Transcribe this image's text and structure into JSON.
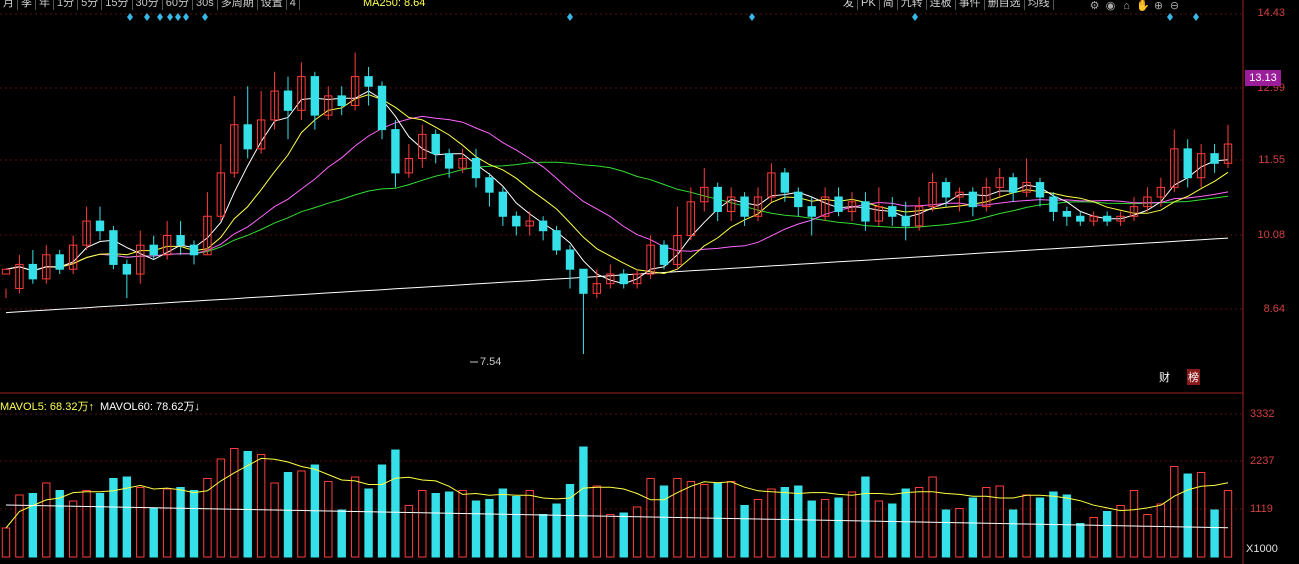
{
  "toolbar": {
    "periods": [
      "月",
      "季",
      "年",
      "1分",
      "5分",
      "15分",
      "30分",
      "60分",
      "30s"
    ],
    "actions": [
      "多周期",
      "设置",
      "4"
    ],
    "ma_status": "MA250: 8.64",
    "right_items": [
      "发",
      "PK",
      "简",
      "九转",
      "连板",
      "事件"
    ],
    "right_items2": [
      "删自选",
      "均线"
    ],
    "icons": [
      "settings-icon",
      "eye-icon",
      "home-icon",
      "hand-icon",
      "zoom-in-icon",
      "zoom-out-icon"
    ]
  },
  "price_axis": [
    "14.43",
    "12.99",
    "11.55",
    "10.08",
    "8.64"
  ],
  "highlight_price": "13.13",
  "low_label": "7.54",
  "badges": {
    "cai": "财",
    "bang": "榜"
  },
  "volume": {
    "mavol5_label": "MAVOL5: 68.32万",
    "mavol5_arrow": "↑",
    "mavol60_label": "MAVOL60: 78.62万",
    "mavol60_arrow": "↓",
    "axis": [
      "3332",
      "2237",
      "1119"
    ],
    "unit": "X1000"
  },
  "colors": {
    "up": "#ff3b3b",
    "down": "#36e0e8",
    "ma5": "#ffffff",
    "ma10": "#ffff44",
    "ma20": "#ff66ff",
    "ma60": "#33dd33",
    "ma250": "#ffffff"
  },
  "chart_data": {
    "type": "candlestick",
    "ylim": [
      7.0,
      14.6
    ],
    "candles": [
      [
        9.2,
        9.3,
        8.9,
        8.7
      ],
      [
        8.9,
        9.4,
        9.6,
        8.8
      ],
      [
        9.4,
        9.1,
        9.7,
        9.0
      ],
      [
        9.1,
        9.6,
        9.8,
        9.0
      ],
      [
        9.6,
        9.3,
        9.7,
        9.2
      ],
      [
        9.3,
        9.8,
        10.0,
        9.2
      ],
      [
        9.8,
        10.3,
        10.6,
        9.7
      ],
      [
        10.3,
        10.1,
        10.6,
        9.9
      ],
      [
        10.1,
        9.4,
        10.2,
        9.3
      ],
      [
        9.4,
        9.2,
        9.5,
        8.7
      ],
      [
        9.2,
        9.8,
        10.1,
        9.0
      ],
      [
        9.8,
        9.6,
        10.0,
        9.5
      ],
      [
        9.6,
        10.0,
        10.3,
        9.5
      ],
      [
        10.0,
        9.8,
        10.3,
        9.6
      ],
      [
        9.8,
        9.6,
        9.9,
        9.4
      ],
      [
        9.6,
        10.4,
        10.9,
        9.6
      ],
      [
        10.4,
        11.3,
        11.9,
        10.3
      ],
      [
        11.3,
        12.3,
        12.9,
        11.2
      ],
      [
        12.3,
        11.8,
        13.1,
        11.6
      ],
      [
        11.8,
        12.4,
        13.0,
        11.7
      ],
      [
        12.4,
        13.0,
        13.4,
        12.2
      ],
      [
        13.0,
        12.6,
        13.3,
        12.0
      ],
      [
        12.6,
        13.3,
        13.6,
        12.4
      ],
      [
        13.3,
        12.5,
        13.4,
        12.2
      ],
      [
        12.5,
        12.9,
        13.1,
        12.4
      ],
      [
        12.9,
        12.7,
        13.1,
        12.5
      ],
      [
        12.7,
        13.3,
        13.8,
        12.6
      ],
      [
        13.3,
        13.1,
        13.5,
        12.7
      ],
      [
        13.1,
        12.2,
        13.2,
        12.0
      ],
      [
        12.2,
        11.3,
        12.4,
        11.0
      ],
      [
        11.3,
        11.6,
        11.9,
        11.2
      ],
      [
        11.6,
        12.1,
        12.3,
        11.4
      ],
      [
        12.1,
        11.7,
        12.2,
        11.5
      ],
      [
        11.7,
        11.4,
        11.8,
        11.2
      ],
      [
        11.4,
        11.6,
        11.8,
        11.3
      ],
      [
        11.6,
        11.2,
        11.8,
        11.0
      ],
      [
        11.2,
        10.9,
        11.3,
        10.6
      ],
      [
        10.9,
        10.4,
        11.0,
        10.2
      ],
      [
        10.4,
        10.2,
        10.5,
        10.0
      ],
      [
        10.2,
        10.3,
        10.5,
        10.0
      ],
      [
        10.3,
        10.1,
        10.4,
        9.9
      ],
      [
        10.1,
        9.7,
        10.2,
        9.6
      ],
      [
        9.7,
        9.3,
        9.8,
        8.9
      ],
      [
        9.3,
        8.8,
        9.3,
        7.54
      ],
      [
        8.8,
        9.0,
        9.3,
        8.7
      ],
      [
        9.0,
        9.2,
        9.4,
        8.9
      ],
      [
        9.2,
        9.0,
        9.3,
        8.9
      ],
      [
        9.0,
        9.2,
        9.3,
        8.9
      ],
      [
        9.2,
        9.8,
        10.0,
        9.1
      ],
      [
        9.8,
        9.4,
        9.9,
        9.3
      ],
      [
        9.4,
        10.0,
        10.6,
        9.3
      ],
      [
        10.0,
        10.7,
        11.0,
        9.9
      ],
      [
        10.7,
        11.0,
        11.4,
        10.5
      ],
      [
        11.0,
        10.5,
        11.1,
        10.3
      ],
      [
        10.5,
        10.8,
        11.0,
        10.3
      ],
      [
        10.8,
        10.4,
        10.9,
        10.2
      ],
      [
        10.4,
        10.8,
        11.0,
        10.3
      ],
      [
        10.8,
        11.3,
        11.5,
        10.7
      ],
      [
        11.3,
        10.9,
        11.4,
        10.7
      ],
      [
        10.9,
        10.6,
        11.0,
        10.4
      ],
      [
        10.6,
        10.4,
        10.8,
        10.0
      ],
      [
        10.4,
        10.8,
        11.0,
        10.3
      ],
      [
        10.8,
        10.5,
        11.0,
        10.4
      ],
      [
        10.5,
        10.7,
        10.9,
        10.3
      ],
      [
        10.7,
        10.3,
        10.9,
        10.1
      ],
      [
        10.3,
        10.6,
        11.0,
        10.2
      ],
      [
        10.6,
        10.4,
        10.8,
        10.2
      ],
      [
        10.4,
        10.2,
        10.7,
        9.9
      ],
      [
        10.2,
        10.6,
        10.8,
        10.1
      ],
      [
        10.6,
        11.1,
        11.3,
        10.5
      ],
      [
        11.1,
        10.8,
        11.2,
        10.6
      ],
      [
        10.8,
        10.9,
        11.0,
        10.5
      ],
      [
        10.9,
        10.6,
        11.0,
        10.4
      ],
      [
        10.6,
        11.0,
        11.2,
        10.5
      ],
      [
        11.0,
        11.2,
        11.4,
        10.8
      ],
      [
        11.2,
        10.9,
        11.3,
        10.7
      ],
      [
        10.9,
        11.1,
        11.6,
        10.8
      ],
      [
        11.1,
        10.8,
        11.2,
        10.6
      ],
      [
        10.8,
        10.5,
        10.9,
        10.3
      ],
      [
        10.5,
        10.4,
        10.6,
        10.2
      ],
      [
        10.4,
        10.3,
        10.5,
        10.2
      ],
      [
        10.3,
        10.4,
        10.5,
        10.2
      ],
      [
        10.4,
        10.3,
        10.5,
        10.2
      ],
      [
        10.3,
        10.4,
        10.5,
        10.2
      ],
      [
        10.4,
        10.6,
        10.8,
        10.3
      ],
      [
        10.6,
        10.8,
        11.0,
        10.5
      ],
      [
        10.8,
        11.0,
        11.2,
        10.6
      ],
      [
        11.0,
        11.8,
        12.2,
        10.9
      ],
      [
        11.8,
        11.2,
        12.0,
        11.0
      ],
      [
        11.2,
        11.7,
        11.9,
        11.0
      ],
      [
        11.7,
        11.5,
        11.9,
        11.3
      ],
      [
        11.5,
        11.9,
        12.3,
        11.4
      ]
    ]
  }
}
